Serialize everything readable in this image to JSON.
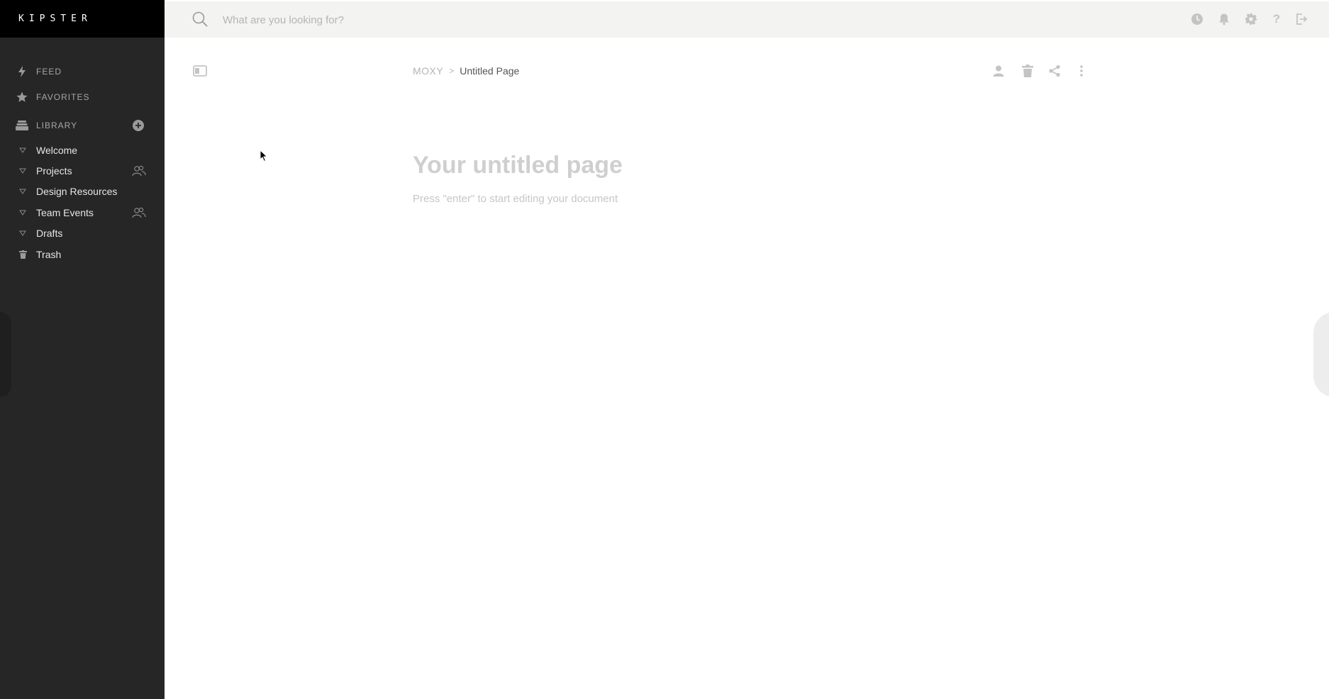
{
  "app": {
    "brand": "KIPSTER"
  },
  "search": {
    "placeholder": "What are you looking for?"
  },
  "topbar": {
    "icons": [
      "history-icon",
      "bell-icon",
      "gear-icon",
      "help-icon",
      "logout-icon"
    ]
  },
  "sidebar": {
    "nav": [
      {
        "label": "FEED",
        "icon": "lightning-icon"
      },
      {
        "label": "FAVORITES",
        "icon": "star-icon"
      },
      {
        "label": "LIBRARY",
        "icon": "stack-icon"
      }
    ],
    "library_items": [
      {
        "label": "Welcome",
        "shared": false
      },
      {
        "label": "Projects",
        "shared": true
      },
      {
        "label": "Design Resources",
        "shared": false
      },
      {
        "label": "Team Events",
        "shared": true
      },
      {
        "label": "Drafts",
        "shared": false
      },
      {
        "label": "Trash",
        "icon": "trash-icon"
      }
    ]
  },
  "breadcrumb": {
    "root": "MOXY",
    "separator": ">",
    "current": "Untitled Page"
  },
  "document": {
    "title_placeholder": "Your untitled page",
    "hint": "Press \"enter\" to start editing your document"
  },
  "colors": {
    "sidebar_bg": "#262626",
    "brand_bg": "#000000",
    "topbar_bg": "#f3f3f2",
    "content_bg": "#ffffff"
  }
}
